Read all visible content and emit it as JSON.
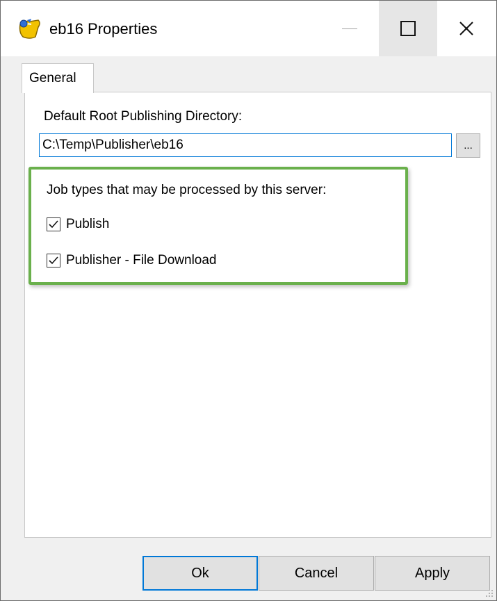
{
  "window": {
    "title": "eb16 Properties",
    "icon": "publisher-app-icon"
  },
  "titlebar_buttons": {
    "minimize": "minimize-icon",
    "maximize": "maximize-icon",
    "close": "close-icon"
  },
  "tabs": [
    {
      "label": "General",
      "active": true
    }
  ],
  "general": {
    "root_dir_label": "Default Root Publishing Directory:",
    "root_dir_value": "C:\\Temp\\Publisher\\eb16",
    "browse_label": "...",
    "job_types_label": "Job types that may be processed by this server:",
    "job_types": [
      {
        "label": "Publish",
        "checked": true
      },
      {
        "label": "Publisher - File Download",
        "checked": true
      }
    ]
  },
  "buttons": {
    "ok": "Ok",
    "cancel": "Cancel",
    "apply": "Apply"
  },
  "colors": {
    "highlight": "#6ab04c",
    "focus": "#0078d7"
  }
}
